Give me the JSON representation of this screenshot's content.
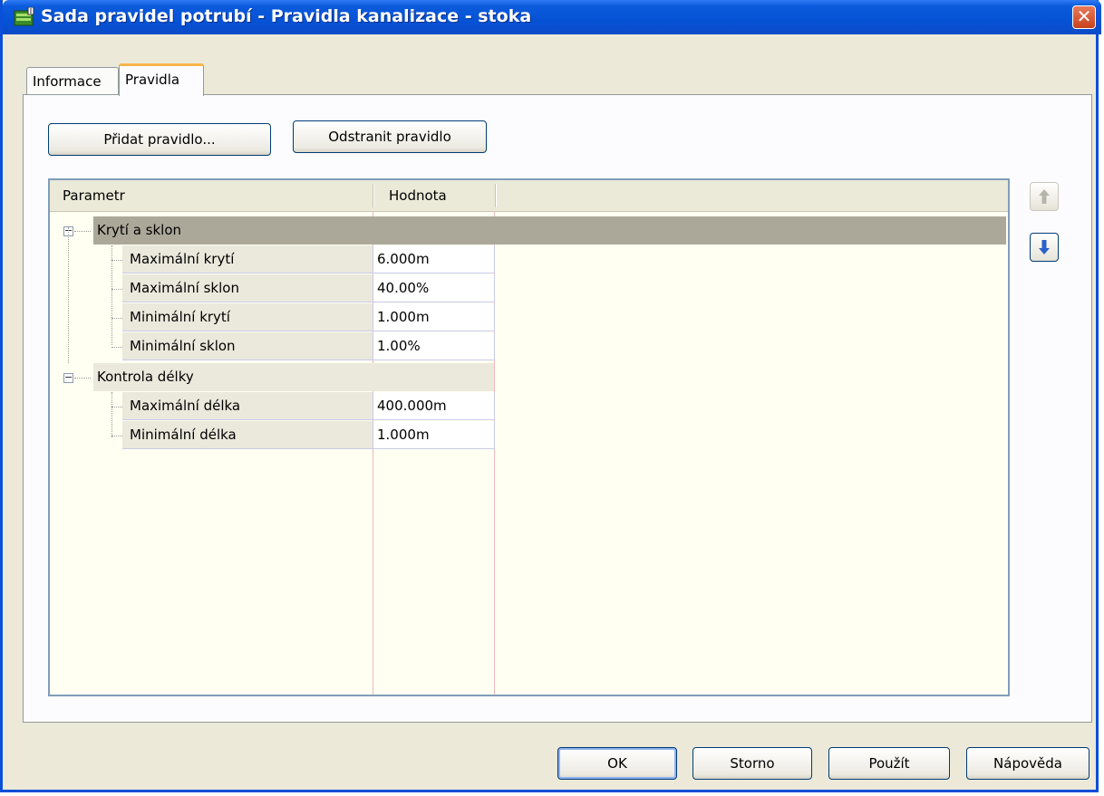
{
  "window": {
    "title": "Sada pravidel potrubí - Pravidla kanalizace - stoka",
    "close_glyph": "✕"
  },
  "tabs": [
    {
      "label": "Informace",
      "active": false
    },
    {
      "label": "Pravidla",
      "active": true
    }
  ],
  "toolbar": {
    "add_rule_label": "Přidat pravidlo...",
    "remove_rule_label": "Odstranit pravidlo"
  },
  "grid": {
    "columns": [
      "Parametr",
      "Hodnota"
    ],
    "groups": [
      {
        "name": "Krytí a sklon",
        "expanded": true,
        "selected": true,
        "rows": [
          {
            "param": "Maximální krytí",
            "value": "6.000m"
          },
          {
            "param": "Maximální sklon",
            "value": "40.00%"
          },
          {
            "param": "Minimální krytí",
            "value": "1.000m"
          },
          {
            "param": "Minimální sklon",
            "value": "1.00%"
          }
        ]
      },
      {
        "name": "Kontrola délky",
        "expanded": true,
        "selected": false,
        "rows": [
          {
            "param": "Maximální délka",
            "value": "400.000m"
          },
          {
            "param": "Minimální délka",
            "value": "1.000m"
          }
        ]
      }
    ]
  },
  "side_buttons": {
    "move_up_icon": "arrow-up-icon",
    "move_down_icon": "arrow-down-icon"
  },
  "footer": {
    "ok_label": "OK",
    "cancel_label": "Storno",
    "apply_label": "Použít",
    "help_label": "Nápověda"
  },
  "colors": {
    "titlebar": "#0652d6",
    "dialog_bg": "#ece9d8",
    "grid_bg": "#fffff2",
    "selected_group": "#aca899",
    "group_bg": "#ebe8dc"
  }
}
